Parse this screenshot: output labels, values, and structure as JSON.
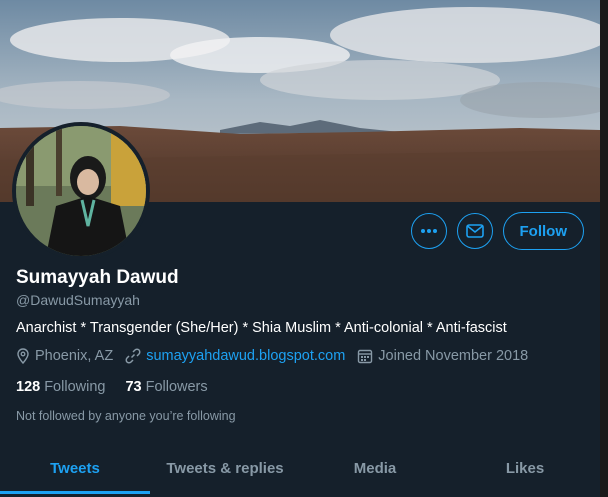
{
  "profile": {
    "name": "Sumayyah Dawud",
    "handle": "@DawudSumayyah",
    "bio": "Anarchist * Transgender (She/Her) * Shia Muslim * Anti-colonial * Anti-fascist",
    "location": "Phoenix, AZ",
    "website": "sumayyahdawud.blogspot.com",
    "joined": "Joined November 2018",
    "following_count": "128",
    "following_label": "Following",
    "followers_count": "73",
    "followers_label": "Followers",
    "followed_by": "Not followed by anyone you’re following"
  },
  "actions": {
    "more_icon": "more-dots-icon",
    "message_icon": "envelope-icon",
    "follow_label": "Follow"
  },
  "tabs": [
    {
      "label": "Tweets",
      "active": true
    },
    {
      "label": "Tweets & replies",
      "active": false
    },
    {
      "label": "Media",
      "active": false
    },
    {
      "label": "Likes",
      "active": false
    }
  ],
  "colors": {
    "background": "#15202b",
    "accent": "#1da1f2",
    "secondary_text": "#8899a6"
  }
}
